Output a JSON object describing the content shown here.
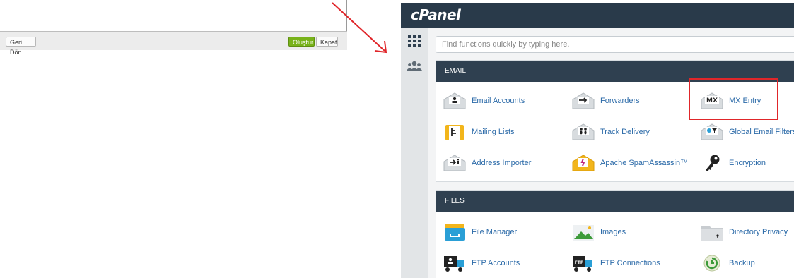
{
  "dialog": {
    "back_label": "Geri Dön",
    "create_label": "Oluştur",
    "close_label": "Kapat"
  },
  "cpanel": {
    "logo": "cPanel",
    "search_placeholder": "Find functions quickly by typing here.",
    "sections": [
      {
        "title": "EMAIL",
        "items": [
          {
            "label": "Email Accounts",
            "icon": "email-accounts-icon"
          },
          {
            "label": "Forwarders",
            "icon": "forwarders-icon"
          },
          {
            "label": "MX Entry",
            "icon": "mx-entry-icon"
          },
          {
            "label": "Mailing Lists",
            "icon": "mailing-lists-icon"
          },
          {
            "label": "Track Delivery",
            "icon": "track-delivery-icon"
          },
          {
            "label": "Global Email Filters",
            "icon": "global-email-filters-icon"
          },
          {
            "label": "Address Importer",
            "icon": "address-importer-icon"
          },
          {
            "label": "Apache SpamAssassin™",
            "icon": "spamassassin-icon"
          },
          {
            "label": "Encryption",
            "icon": "encryption-key-icon"
          }
        ]
      },
      {
        "title": "FILES",
        "items": [
          {
            "label": "File Manager",
            "icon": "file-manager-icon"
          },
          {
            "label": "Images",
            "icon": "images-icon"
          },
          {
            "label": "Directory Privacy",
            "icon": "directory-privacy-icon"
          },
          {
            "label": "FTP Accounts",
            "icon": "ftp-accounts-icon"
          },
          {
            "label": "FTP Connections",
            "icon": "ftp-connections-icon"
          },
          {
            "label": "Backup",
            "icon": "backup-icon"
          }
        ]
      }
    ]
  },
  "colors": {
    "cpanel_header": "#293a4a",
    "section_header": "#2f4050",
    "link": "#2b6aa8",
    "create_button": "#78b21a",
    "highlight_arrow": "#e0262a"
  }
}
